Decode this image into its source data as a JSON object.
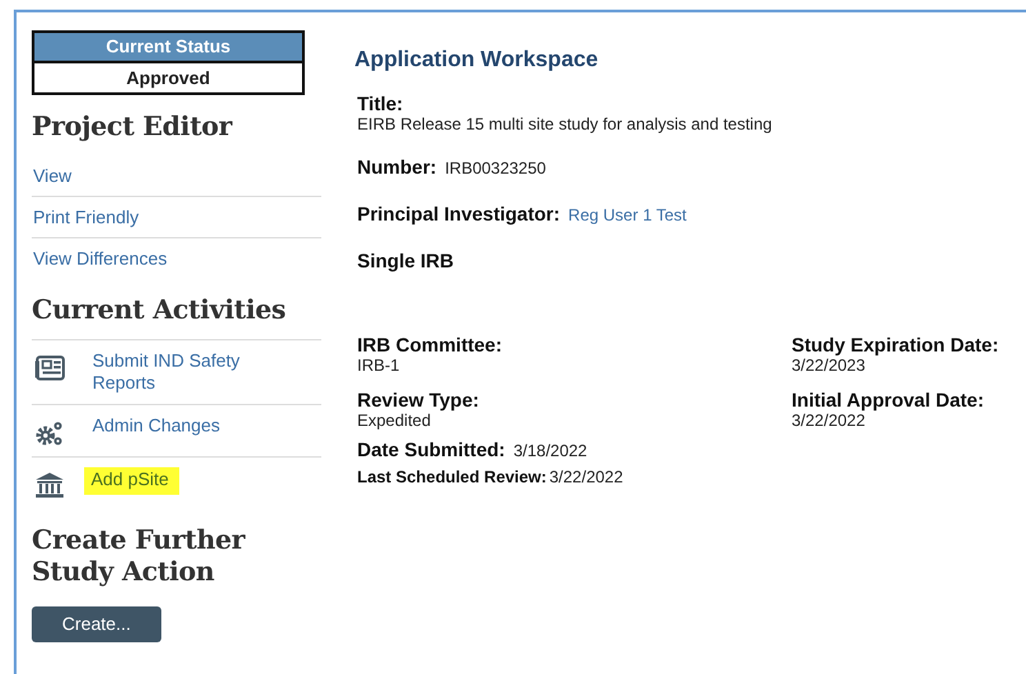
{
  "sidebar": {
    "status": {
      "heading": "Current Status",
      "value": "Approved"
    },
    "project_editor": {
      "heading": "Project Editor",
      "links": [
        "View",
        "Print Friendly",
        "View Differences"
      ]
    },
    "current_activities": {
      "heading": "Current Activities",
      "items": [
        {
          "label": "Submit IND Safety Reports",
          "kind": "newspaper",
          "highlighted": false
        },
        {
          "label": "Admin Changes",
          "kind": "gears",
          "highlighted": false
        },
        {
          "label": "Add pSite",
          "kind": "bank",
          "highlighted": true
        }
      ]
    },
    "further_action": {
      "heading": "Create Further Study Action",
      "button": "Create..."
    }
  },
  "workspace": {
    "heading": "Application Workspace",
    "fields": [
      {
        "kind": "stacked",
        "label": "Title:",
        "value": "EIRB Release 15 multi site study for analysis and testing"
      },
      {
        "kind": "inline",
        "label": "Number:",
        "value": "IRB00323250"
      },
      {
        "kind": "link",
        "label": "Principal Investigator:",
        "value": "Reg User 1 Test"
      },
      {
        "kind": "heading",
        "label": "Single IRB"
      }
    ],
    "grid": [
      {
        "label": "IRB Committee:",
        "value": "IRB-1"
      },
      {
        "label": "Study Expiration Date:",
        "value": "3/22/2023"
      },
      {
        "label": "Review Type:",
        "value": "Expedited"
      },
      {
        "label": "Initial Approval Date:",
        "value": "3/22/2022"
      }
    ],
    "footer_fields": [
      {
        "kind": "inline",
        "label": "Date Submitted:",
        "value": "3/18/2022"
      },
      {
        "kind": "small",
        "label": "Last Scheduled Review:",
        "value": "3/22/2022"
      }
    ]
  }
}
